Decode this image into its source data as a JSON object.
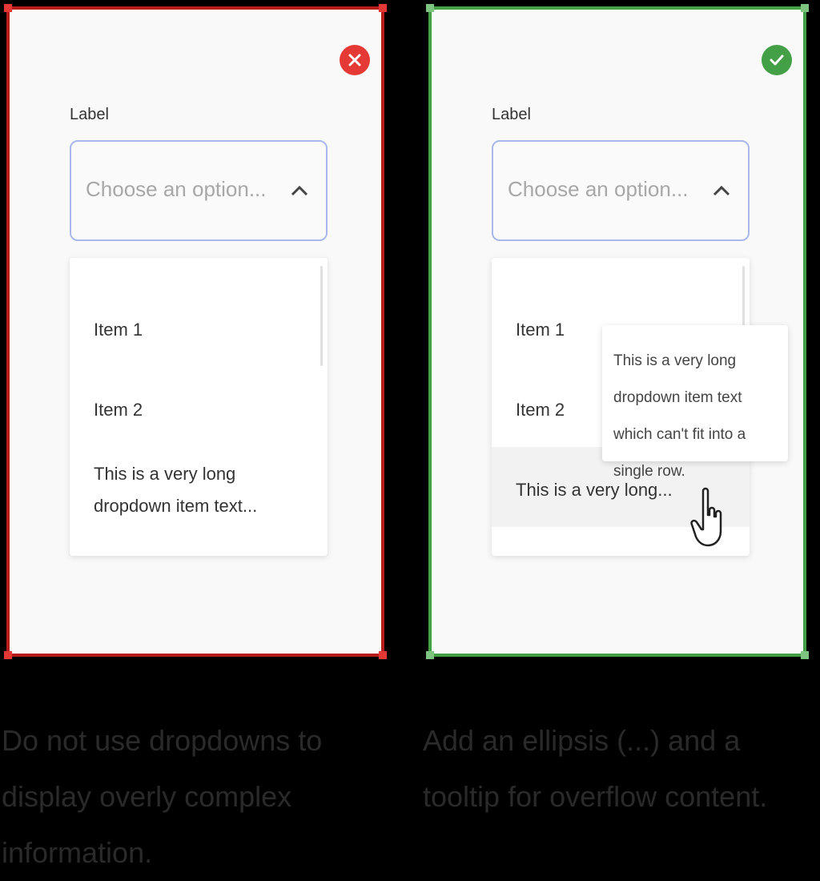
{
  "dont_example": {
    "label": "Label",
    "placeholder": "Choose an option...",
    "items": [
      "Item 1",
      "Item 2",
      "This is a very long dropdown item text..."
    ],
    "caption": "Do not use dropdowns to display overly complex information.",
    "status": "dont",
    "status_icon": "close-icon",
    "accent_color": "#e53935"
  },
  "do_example": {
    "label": "Label",
    "placeholder": "Choose an option...",
    "items": [
      "Item 1",
      "Item 2",
      "This is a very long..."
    ],
    "tooltip": "This is a very long dropdown item text which can't fit into a single row.",
    "caption": "Add an ellipsis (...) and a tooltip for overflow content.",
    "status": "do",
    "status_icon": "check-icon",
    "accent_color": "#43a047"
  }
}
